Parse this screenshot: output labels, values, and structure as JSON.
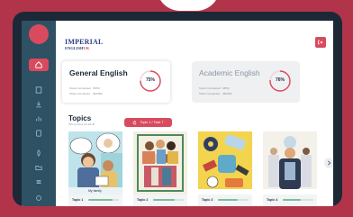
{
  "brand": {
    "logo_line1": "IMPERIAL",
    "logo_line2_a": "ENGLISH",
    "logo_line2_b": "UK",
    "accent": "#d94a5e",
    "sidebar_color": "#2e5163",
    "frame_color": "#b2344a"
  },
  "sidebar": {
    "items": [
      {
        "icon": "home-icon",
        "active": true
      },
      {
        "icon": "book-icon",
        "active": false
      },
      {
        "icon": "download-icon",
        "active": false
      },
      {
        "icon": "chart-icon",
        "active": false
      },
      {
        "icon": "document-icon",
        "active": false
      },
      {
        "icon": "rocket-icon",
        "active": false
      },
      {
        "icon": "folder-icon",
        "active": false
      },
      {
        "icon": "list-icon",
        "active": false
      },
      {
        "icon": "settings-icon",
        "active": false
      }
    ]
  },
  "header": {
    "logout_icon": "logout-icon"
  },
  "courses": [
    {
      "title": "General English",
      "progress": 0.75,
      "progress_label": "75%",
      "stats": [
        {
          "label": "Topics Completed",
          "value": "35/50"
        },
        {
          "label": "Tasks Completed",
          "value": "300/500"
        }
      ],
      "ring_color": "#d94a5e"
    },
    {
      "title": "Academic English",
      "progress": 0.76,
      "progress_label": "76%",
      "stats": [
        {
          "label": "Topics Completed",
          "value": "38/50"
        },
        {
          "label": "Tasks Completed",
          "value": "380/500"
        }
      ],
      "ring_color": "#d94a5e"
    }
  ],
  "topics": {
    "title": "Topics",
    "subtitle": "Pick up where you left off",
    "filter_label": "Topic 1 / Task 7",
    "items": [
      {
        "name": "Topic 1",
        "progress": 0.8,
        "caption": "My family"
      },
      {
        "name": "Topic 2",
        "progress": 0.7
      },
      {
        "name": "Topic 3",
        "progress": 0.65
      },
      {
        "name": "Topic 4",
        "progress": 0.6
      }
    ],
    "next_icon": "chevron-right-icon"
  }
}
